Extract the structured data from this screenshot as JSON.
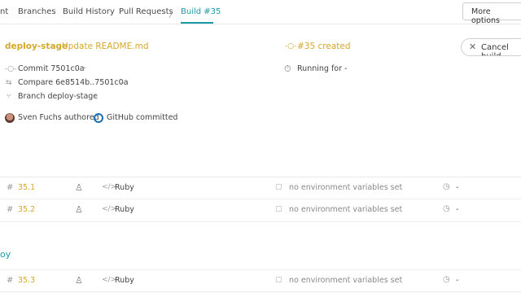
{
  "tabs": [
    {
      "label": "nt"
    },
    {
      "label": "Branches"
    },
    {
      "label": "Build History"
    },
    {
      "label": "Pull Requests"
    },
    {
      "label": "Build #35"
    }
  ],
  "crumb_separator": "〉",
  "more_options_label": "More options",
  "build": {
    "branch": "deploy-stage",
    "commit_message": "Update README.md",
    "status": "#35 created",
    "cancel_label": "Cancel build",
    "commit": "Commit 7501c0a",
    "compare": "Compare 6e8514b..7501c0a",
    "branch_link": "Branch deploy-stage",
    "running": "Running for -",
    "author": "Sven Fuchs authored",
    "committer": "GitHub committed"
  },
  "jobs_section_1": [
    {
      "hash": "#",
      "number": "35.1",
      "language": "Ruby",
      "env": "no environment variables set",
      "duration": "-"
    },
    {
      "hash": "#",
      "number": "35.2",
      "language": "Ruby",
      "env": "no environment variables set",
      "duration": "-"
    }
  ],
  "section_2_label": "oy",
  "jobs_section_2": [
    {
      "hash": "#",
      "number": "35.3",
      "language": "Ruby",
      "env": "no environment variables set",
      "duration": "-"
    }
  ],
  "colors": {
    "accent": "#1c9aa8",
    "created": "#d4a82a"
  },
  "icons": {
    "commit": "commit-icon",
    "compare": "compare-icon",
    "branch": "branch-icon",
    "external": "external-link-icon",
    "stopwatch": "stopwatch-icon",
    "robot": "robot-icon",
    "code": "code-icon",
    "env": "box-icon",
    "clock": "clock-icon"
  }
}
